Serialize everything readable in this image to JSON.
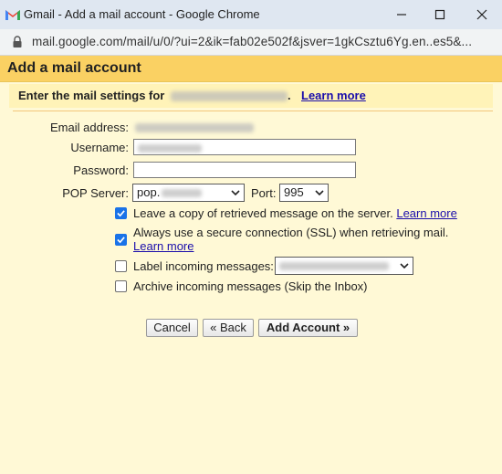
{
  "window": {
    "title": "Gmail - Add a mail account - Google Chrome",
    "url": "mail.google.com/mail/u/0/?ui=2&ik=fab02e502f&jsver=1gkCsztu6Yg.en..es5&..."
  },
  "dialog": {
    "title": "Add a mail account",
    "intro_prefix": "Enter the mail settings for",
    "intro_suffix": ".",
    "intro_link": "Learn more"
  },
  "form": {
    "email_label": "Email address:",
    "username_label": "Username:",
    "password_label": "Password:",
    "pop_server_label": "POP Server:",
    "pop_server_value": "pop.",
    "port_label": "Port:",
    "port_value": "995",
    "leave_copy": {
      "checked": true,
      "label": "Leave a copy of retrieved message on the server.",
      "link": "Learn more"
    },
    "ssl": {
      "checked": true,
      "label": "Always use a secure connection (SSL) when retrieving mail.",
      "link": "Learn more"
    },
    "label_incoming": {
      "checked": false,
      "label": "Label incoming messages:"
    },
    "archive_incoming": {
      "checked": false,
      "label": "Archive incoming messages (Skip the Inbox)"
    }
  },
  "buttons": {
    "cancel": "Cancel",
    "back": "« Back",
    "add_account": "Add Account »"
  },
  "colors": {
    "header": "#fad163",
    "background": "#fff9d6",
    "link": "#1a0dab",
    "checkbox": "#1a73e8"
  }
}
